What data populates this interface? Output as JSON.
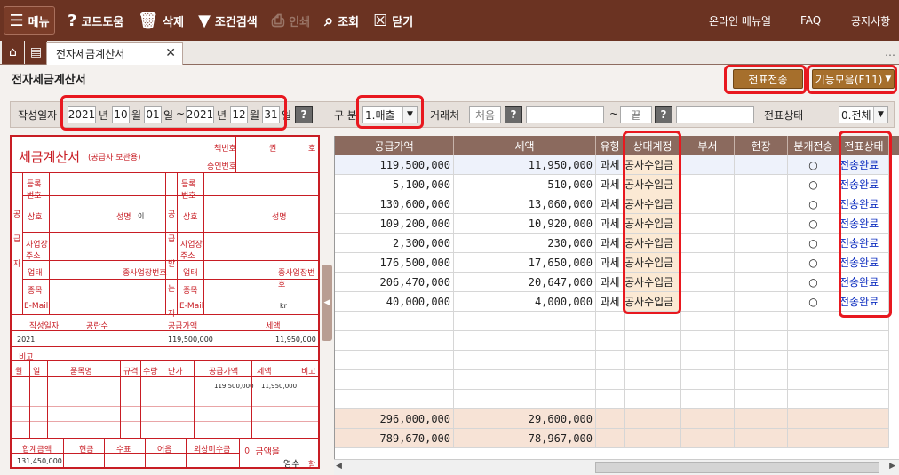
{
  "toolbar": {
    "menu": "메뉴",
    "code_help": "코드도움",
    "delete": "삭제",
    "condition_search": "조건검색",
    "print": "인쇄",
    "search": "조회",
    "close": "닫기",
    "online_manual": "온라인 메뉴얼",
    "faq": "FAQ",
    "notice": "공지사항"
  },
  "tabs": {
    "active": "전자세금계산서"
  },
  "page": {
    "title": "전자세금계산서",
    "send_button": "전표전송",
    "functions_button": "기능모음(F11)"
  },
  "filter": {
    "date_label": "작성일자",
    "from_year": "2021",
    "from_month": "10",
    "from_day": "01",
    "to_year": "2021",
    "to_month": "12",
    "to_day": "31",
    "year": "년",
    "month": "월",
    "day": "일",
    "tilde": "~",
    "type_label": "구 분",
    "type_value": "1.매출",
    "partner_label": "거래처",
    "partner_from": "처음",
    "partner_to": "끝",
    "status_label": "전표상태",
    "status_value": "0.전체"
  },
  "invoice": {
    "title": "세금계산서",
    "subtitle": "(공급자 보관용)",
    "book_no": "책번호",
    "kwon": "권",
    "ho": "호",
    "approval_no": "승인번호",
    "supplier": "공급자",
    "receiver": "공급받는자",
    "reg_no": "등록번호",
    "company": "상호",
    "name": "성명",
    "name_value": "이",
    "address": "사업장주소",
    "business": "업태",
    "category": "종목",
    "branch_no": "종사업장번호",
    "email": "E-Mail",
    "email_value": "kr",
    "date_col": "작성일자",
    "blank_col": "공란수",
    "supply_col": "공급가액",
    "tax_col": "세액",
    "date_value": "2021",
    "supply_value": "119,500,000",
    "tax_value": "11,950,000",
    "remarks": "비고",
    "item_headers": [
      "월",
      "일",
      "품목명",
      "규격",
      "수량",
      "단가",
      "공급가액",
      "세액",
      "비고"
    ],
    "item_supply": "119,500,000",
    "item_tax": "11,950,000",
    "bottom_headers": [
      "합계금액",
      "현금",
      "수표",
      "어음",
      "외상미수금"
    ],
    "total_value": "131,450,000",
    "amount_text": "이 금액을",
    "receipt": "영수",
    "ham": "함"
  },
  "grid": {
    "headers": [
      "공급가액",
      "세액",
      "유형",
      "상대계정",
      "부서",
      "현장",
      "분개전송",
      "전표상태"
    ],
    "rows": [
      [
        "119,500,000",
        "11,950,000",
        "과세",
        "공사수입금",
        "",
        "",
        "○",
        "전송완료"
      ],
      [
        "5,100,000",
        "510,000",
        "과세",
        "공사수입금",
        "",
        "",
        "○",
        "전송완료"
      ],
      [
        "130,600,000",
        "13,060,000",
        "과세",
        "공사수입금",
        "",
        "",
        "○",
        "전송완료"
      ],
      [
        "109,200,000",
        "10,920,000",
        "과세",
        "공사수입금",
        "",
        "",
        "○",
        "전송완료"
      ],
      [
        "2,300,000",
        "230,000",
        "과세",
        "공사수입금",
        "",
        "",
        "○",
        "전송완료"
      ],
      [
        "176,500,000",
        "17,650,000",
        "과세",
        "공사수입금",
        "",
        "",
        "○",
        "전송완료"
      ],
      [
        "206,470,000",
        "20,647,000",
        "과세",
        "공사수입금",
        "",
        "",
        "○",
        "전송완료"
      ],
      [
        "40,000,000",
        "4,000,000",
        "과세",
        "공사수입금",
        "",
        "",
        "○",
        "전송완료"
      ]
    ],
    "totals": [
      [
        "296,000,000",
        "29,600,000"
      ],
      [
        "789,670,000",
        "78,967,000"
      ]
    ]
  },
  "colors": {
    "toolbar": "#6b3322",
    "accent": "#a66f2c",
    "highlight": "#e8181f"
  }
}
